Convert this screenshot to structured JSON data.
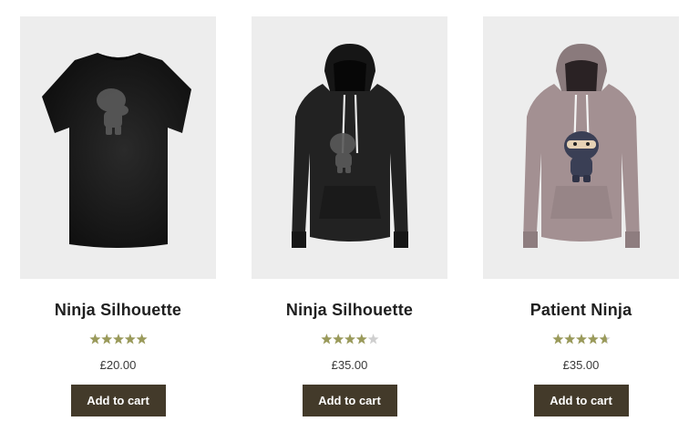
{
  "products": [
    {
      "title": "Ninja Silhouette",
      "rating": 5.0,
      "rating_max": 5,
      "price": "£20.00",
      "button_label": "Add to cart"
    },
    {
      "title": "Ninja Silhouette",
      "rating": 4.0,
      "rating_max": 5,
      "price": "£35.00",
      "button_label": "Add to cart"
    },
    {
      "title": "Patient Ninja",
      "rating": 4.67,
      "rating_max": 5,
      "price": "£35.00",
      "button_label": "Add to cart"
    }
  ],
  "colors": {
    "star_fill": "#9a9a5a",
    "star_empty": "#cfcfcf",
    "button_bg": "#433a2a",
    "thumb_bg": "#ededed"
  }
}
